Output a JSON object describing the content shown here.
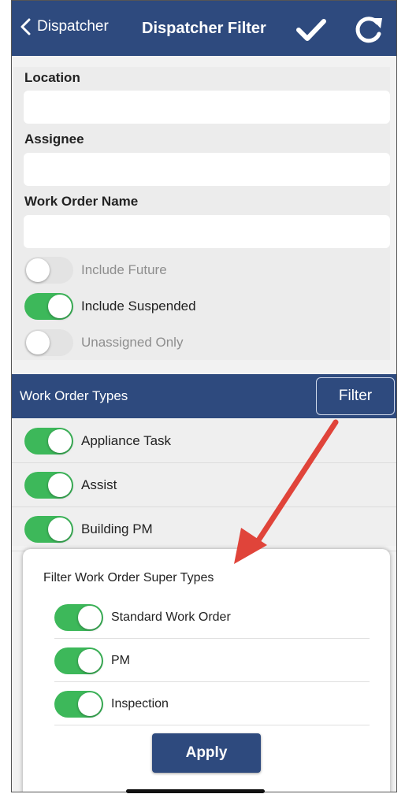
{
  "header": {
    "back_label": "Dispatcher",
    "title": "Dispatcher Filter",
    "confirm_icon": "checkmark-icon",
    "refresh_icon": "refresh-icon"
  },
  "form": {
    "location_label": "Location",
    "location_value": "",
    "assignee_label": "Assignee",
    "assignee_value": "",
    "work_order_name_label": "Work Order Name",
    "work_order_name_value": "",
    "toggles": [
      {
        "label": "Include Future",
        "on": false
      },
      {
        "label": "Include Suspended",
        "on": true
      },
      {
        "label": "Unassigned Only",
        "on": false
      }
    ]
  },
  "section": {
    "title": "Work Order Types",
    "filter_label": "Filter"
  },
  "types": [
    {
      "label": "Appliance Task",
      "on": true
    },
    {
      "label": "Assist",
      "on": true
    },
    {
      "label": "Building PM",
      "on": true
    }
  ],
  "dialog": {
    "title": "Filter Work Order Super Types",
    "options": [
      {
        "label": "Standard Work Order",
        "on": true
      },
      {
        "label": "PM",
        "on": true
      },
      {
        "label": "Inspection",
        "on": true
      }
    ],
    "apply_label": "Apply"
  },
  "colors": {
    "brand": "#2e4a7e",
    "toggle_on": "#3db85a",
    "toggle_off": "#e3e3e3",
    "annotation_arrow": "#e0443a"
  }
}
